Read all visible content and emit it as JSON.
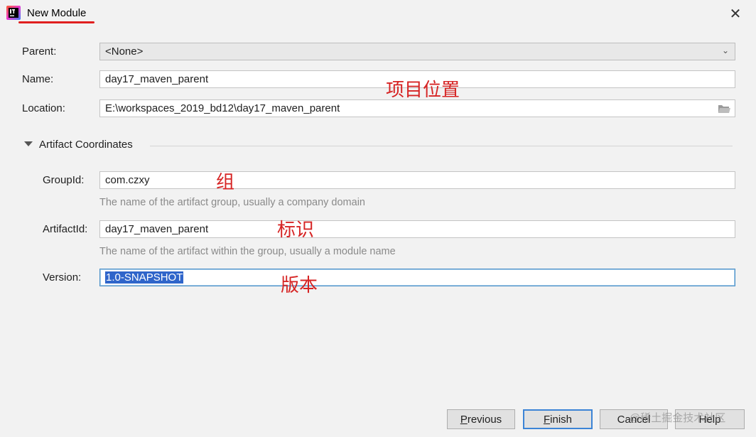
{
  "window": {
    "title": "New Module",
    "app_icon": "intellij-icon",
    "close_icon": "close-icon"
  },
  "form": {
    "parent": {
      "label": "Parent:",
      "value": "<None>"
    },
    "name": {
      "label": "Name:",
      "value": "day17_maven_parent"
    },
    "location": {
      "label": "Location:",
      "value": "E:\\workspaces_2019_bd12\\day17_maven_parent",
      "icon": "folder-icon"
    }
  },
  "artifact_coordinates": {
    "section_title": "Artifact Coordinates",
    "group_id": {
      "label": "GroupId:",
      "value": "com.czxy",
      "hint": "The name of the artifact group, usually a company domain"
    },
    "artifact_id": {
      "label": "ArtifactId:",
      "value": "day17_maven_parent",
      "hint": "The name of the artifact within the group, usually a module name"
    },
    "version": {
      "label": "Version:",
      "value": "1.0-SNAPSHOT"
    }
  },
  "annotations": {
    "name": "项目位置",
    "group_id": "组",
    "artifact_id": "标识",
    "version": "版本"
  },
  "buttons": {
    "previous": {
      "mnemonic": "P",
      "rest": "revious"
    },
    "finish": {
      "mnemonic": "F",
      "rest": "inish"
    },
    "cancel": {
      "label": "Cancel"
    },
    "help": {
      "label": "Help"
    }
  },
  "watermark": "@稀土掘金技术社区",
  "colors": {
    "annotation_red": "#d62424",
    "selection_blue": "#2f65ca",
    "default_button_border": "#3c84d6"
  }
}
